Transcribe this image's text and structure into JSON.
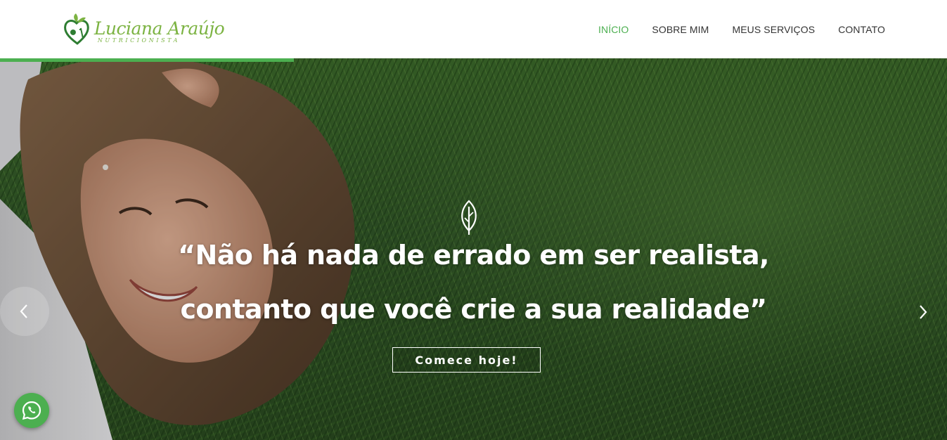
{
  "brand": {
    "name": "Luciana Araújo",
    "subtitle": "NUTRICIONISTA",
    "color": "#7cb342"
  },
  "nav": {
    "items": [
      {
        "label": "INÍCIO",
        "active": true
      },
      {
        "label": "SOBRE MIM",
        "active": false
      },
      {
        "label": "MEUS SERVIÇOS",
        "active": false
      },
      {
        "label": "CONTATO",
        "active": false
      }
    ],
    "active_color": "#4caf50"
  },
  "hero": {
    "icon": "leaf-icon",
    "quote_line_1": "“Não há nada de errado em ser realista,",
    "quote_line_2": "contanto que você crie a sua realidade”",
    "cta_label": "Comece hoje!",
    "slide_progress": 0.31,
    "progress_color": "#4caf50"
  },
  "controls": {
    "prev_icon": "chevron-left-icon",
    "next_icon": "chevron-right-icon"
  },
  "floating": {
    "whatsapp_icon": "whatsapp-icon",
    "whatsapp_color": "#4caf50"
  }
}
